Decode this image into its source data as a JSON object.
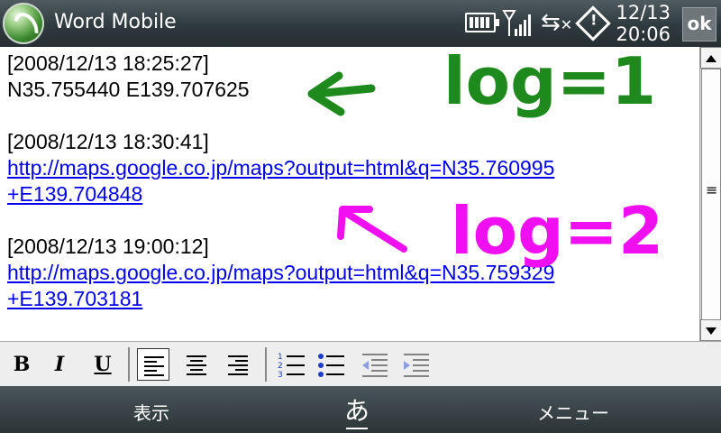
{
  "titlebar": {
    "app_title": "Word Mobile",
    "clock_date": "12/13",
    "clock_time": "20:06",
    "ok_label": "ok"
  },
  "document": {
    "entries": [
      {
        "timestamp": "[2008/12/13 18:25:27]",
        "line": "N35.755440 E139.707625"
      },
      {
        "timestamp": "[2008/12/13 18:30:41]",
        "link_line1": "http://maps.google.co.jp/maps?output=html&q=N35.760995",
        "link_line2": "+E139.704848"
      },
      {
        "timestamp": "[2008/12/13 19:00:12]",
        "link_line1": "http://maps.google.co.jp/maps?output=html&q=N35.759329",
        "link_line2": "+E139.703181"
      }
    ]
  },
  "annotations": {
    "green_label": "log=1",
    "magenta_label": "log=2",
    "green_color": "#1e8a1e",
    "magenta_color": "#f00ff0"
  },
  "toolbar": {
    "bold_label": "B",
    "italic_label": "I",
    "underline_label": "U"
  },
  "softkeys": {
    "left": "表示",
    "middle": "あ",
    "right": "メニュー"
  },
  "icons": [
    "battery-icon",
    "signal-icon",
    "sync-icon",
    "diamond-icon"
  ]
}
